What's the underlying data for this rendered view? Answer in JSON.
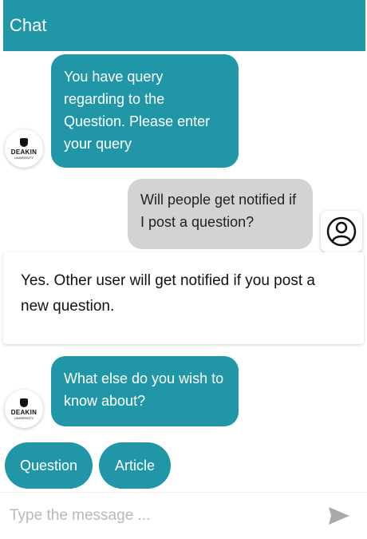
{
  "header": {
    "title": "Chat"
  },
  "messages": {
    "bot_1": "You have query regarding to the Question. Please enter your query",
    "user_1": "Will people get notified if I post a question?",
    "bot_plain": "Yes. Other user will get notified if you post a new question.",
    "bot_2": "What else do you wish to know about?"
  },
  "bot_avatar": {
    "logo_text": "DEAKIN",
    "logo_subtext": "UNIVERSITY"
  },
  "quick_replies": [
    "Question",
    "Article"
  ],
  "composer": {
    "placeholder": "Type the message ..."
  },
  "colors": {
    "accent": "#2196a6",
    "user_bubble": "#d3d3d3",
    "send_icon": "#a9a9a9"
  }
}
